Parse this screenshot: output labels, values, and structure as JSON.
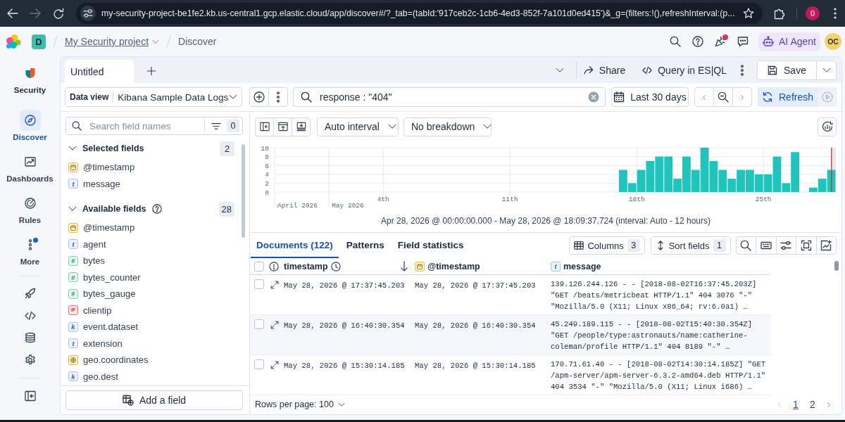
{
  "browser": {
    "back_disabled": false,
    "forward_disabled": true,
    "url": "my-security-project-be1fe2.kb.us-central1.gcp.elastic.cloud/app/discover#/?_tab=(tabId:'917ceb2c-1cb6-4ed3-852f-7a101d0ed415')&_g=(filters:!(),refreshInterval:(p...",
    "profile_initial": "0"
  },
  "header": {
    "space_initial": "D",
    "breadcrumbs": [
      {
        "label": "My Security project",
        "kind": "menu"
      },
      {
        "label": "Discover",
        "kind": "current"
      }
    ],
    "news_unread": true,
    "ai_agent": "AI Agent",
    "avatar_initials": "OC"
  },
  "nav": {
    "items": [
      {
        "label": "Security",
        "selected": false,
        "badge": false
      },
      {
        "label": "Discover",
        "selected": true,
        "badge": false
      },
      {
        "label": "Dashboards",
        "selected": false,
        "badge": false
      },
      {
        "label": "Rules",
        "selected": false,
        "badge": false
      },
      {
        "label": "More",
        "selected": false,
        "badge": true
      }
    ]
  },
  "tabs": [
    {
      "label": "Untitled",
      "selected": true
    }
  ],
  "actions": {
    "share": "Share",
    "query": "Query in ES|QL",
    "save": "Save"
  },
  "toolbar": {
    "data_view_label": "Data view",
    "data_view": "Kibana Sample Data Logs",
    "query": "response : \"404\"",
    "date_range": "Last 30 days",
    "refresh": "Refresh"
  },
  "sidebar": {
    "search": {
      "placeholder": "Search field names"
    },
    "filter_count": "0",
    "sections": [
      {
        "title": "Selected fields",
        "count": "2",
        "expanded": true,
        "help": false,
        "fields": [
          {
            "name": "@timestamp",
            "kind": "date"
          },
          {
            "name": "message",
            "kind": "text",
            "token": "t"
          }
        ]
      },
      {
        "title": "Available fields",
        "count": "28",
        "expanded": true,
        "help": true,
        "fields": [
          {
            "name": "@timestamp",
            "kind": "date"
          },
          {
            "name": "agent",
            "kind": "text",
            "token": "t"
          },
          {
            "name": "bytes",
            "kind": "number",
            "token": "#"
          },
          {
            "name": "bytes_counter",
            "kind": "number",
            "token": "#"
          },
          {
            "name": "bytes_gauge",
            "kind": "number",
            "token": "#"
          },
          {
            "name": "clientip",
            "kind": "ip",
            "token": "IP"
          },
          {
            "name": "event.dataset",
            "kind": "keyword",
            "token": "k"
          },
          {
            "name": "extension",
            "kind": "text",
            "token": "t"
          },
          {
            "name": "geo.coordinates",
            "kind": "geo"
          },
          {
            "name": "geo.dest",
            "kind": "keyword",
            "token": "k"
          }
        ]
      }
    ],
    "add_field": "Add a field"
  },
  "histogram": {
    "interval": "Auto interval",
    "breakdown": "No breakdown",
    "chart_data": {
      "type": "bar",
      "x": [
        17.25,
        17.75,
        18.25,
        18.75,
        19.25,
        19.75,
        20.25,
        20.75,
        21.25,
        21.75,
        22.25,
        22.75,
        23.25,
        23.75,
        24.25,
        24.75,
        25.25,
        25.75,
        26.25,
        26.75,
        27.75,
        28.25,
        28.75
      ],
      "values": [
        5,
        2,
        5,
        7,
        8,
        8,
        3,
        8,
        5,
        10,
        7,
        5,
        3,
        5,
        5,
        4,
        4,
        8,
        2,
        9,
        1,
        3,
        5
      ],
      "xlim": [
        -2,
        29
      ],
      "ylim": [
        0,
        10
      ],
      "xticks": [
        {
          "value": 4,
          "label": "4th"
        },
        {
          "value": 11,
          "label": "11th"
        },
        {
          "value": 18,
          "label": "18th"
        },
        {
          "value": 25,
          "label": "25th"
        }
      ],
      "yticks": [
        0,
        2,
        4,
        6,
        8,
        10
      ],
      "grid": true,
      "ref_lines": [
        {
          "axis": "x",
          "value": 28.76,
          "color": "#bd271e"
        }
      ],
      "bands": [
        {
          "axis": "x",
          "from": 28.76,
          "to": 29,
          "color": "#e6e9ee"
        }
      ]
    },
    "axis_periods": [
      "April 2026",
      "May 2026"
    ],
    "time_range": "Apr 28, 2026 @ 00:00:00.000 - May 28, 2026 @ 18:09:37.724 (interval: Auto - 12 hours)"
  },
  "result_tabs": [
    {
      "label": "Documents (122)",
      "selected": true
    },
    {
      "label": "Patterns",
      "selected": false
    },
    {
      "label": "Field statistics",
      "selected": false
    }
  ],
  "table": {
    "columns_button": {
      "label": "Columns",
      "count": "3"
    },
    "sort_button": {
      "label": "Sort fields",
      "count": "1"
    },
    "all_selected": false,
    "columns": [
      {
        "label": "timestamp",
        "kind": "virtual",
        "sort_descending": true
      },
      {
        "label": "@timestamp",
        "kind": "date"
      },
      {
        "label": "message",
        "kind": "text",
        "token": "t"
      }
    ],
    "rows": [
      {
        "selected": false,
        "cells": [
          "May 28, 2026 @ 17:37:45.203",
          "May 28, 2026 @ 17:37:45.203",
          "139.126.244.126 - - [2018-08-02T16:37:45.203Z] \"GET /beats/metricbeat HTTP/1.1\" 404 3076 \"-\" \"Mozilla/5.0 (X11; Linux x86_64; rv:6.0a1) …"
        ]
      },
      {
        "selected": false,
        "cells": [
          "May 28, 2026 @ 16:40:30.354",
          "May 28, 2026 @ 16:40:30.354",
          "45.249.189.115 - - [2018-08-02T15:40:30.354Z] \"GET /people/type:astronauts/name:catherine-coleman/profile HTTP/1.1\" 404 8189 \"-\" …"
        ]
      },
      {
        "selected": false,
        "cells": [
          "May 28, 2026 @ 15:30:14.185",
          "May 28, 2026 @ 15:30:14.185",
          "170.71.61.40 - - [2018-08-02T14:30:14.185Z] \"GET /apm-server/apm-server-6.3.2-amd64.deb HTTP/1.1\" 404 3534 \"-\" \"Mozilla/5.0 (X11; Linux i686) …"
        ]
      }
    ]
  },
  "footer": {
    "rows_per_page": "Rows per page: 100",
    "previous_disabled": true,
    "next_disabled": false,
    "pages": [
      {
        "label": "1",
        "selected": true
      },
      {
        "label": "2",
        "selected": false
      }
    ]
  }
}
